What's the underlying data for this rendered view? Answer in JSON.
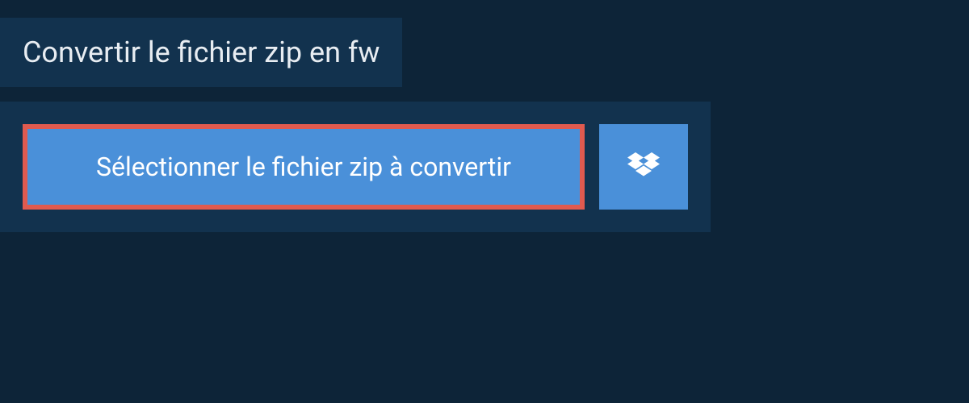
{
  "header": {
    "title": "Convertir le fichier zip en fw"
  },
  "converter": {
    "select_button_label": "Sélectionner le fichier zip à convertir"
  }
}
